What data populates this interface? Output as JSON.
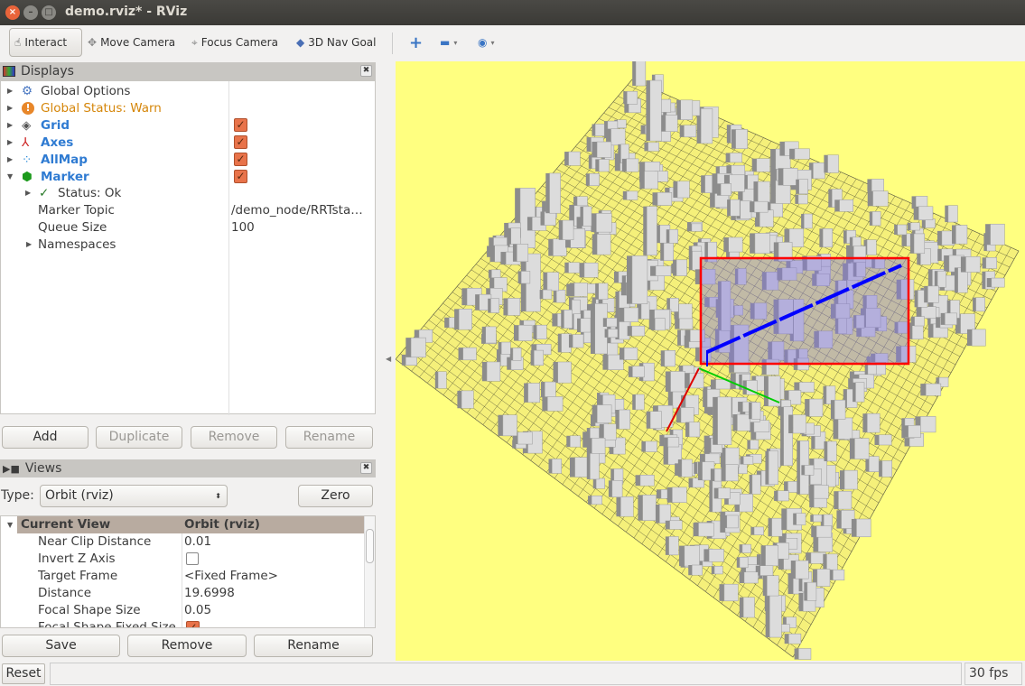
{
  "window": {
    "title": "demo.rviz* - RViz"
  },
  "toolbar": {
    "tools": [
      {
        "label": "Interact",
        "icon": "hand-icon",
        "active": true
      },
      {
        "label": "Move Camera",
        "icon": "move-camera-icon"
      },
      {
        "label": "Focus Camera",
        "icon": "focus-camera-icon"
      },
      {
        "label": "3D Nav Goal",
        "icon": "nav-goal-icon"
      }
    ],
    "extra_icons": [
      "plus-icon",
      "minus-icon",
      "eye-icon"
    ]
  },
  "displays": {
    "title": "Displays",
    "items": [
      {
        "label": "Global Options",
        "icon": "gear-icon",
        "color": "#3c3c3c"
      },
      {
        "label": "Global Status: Warn",
        "icon": "warning-icon",
        "color": "#d5860a"
      },
      {
        "label": "Grid",
        "icon": "grid-icon",
        "color": "#2f7bd2",
        "checked": true
      },
      {
        "label": "Axes",
        "icon": "axes-icon",
        "color": "#2f7bd2",
        "checked": true
      },
      {
        "label": "AllMap",
        "icon": "pointcloud-icon",
        "color": "#2f7bd2",
        "checked": true
      },
      {
        "label": "Marker",
        "icon": "cube-icon",
        "color": "#2f7bd2",
        "checked": true
      }
    ],
    "marker_children": {
      "status": "Status: Ok",
      "topic_label": "Marker Topic",
      "topic_value": "/demo_node/RRTsta…",
      "queue_label": "Queue Size",
      "queue_value": "100",
      "namespaces": "Namespaces"
    },
    "buttons": {
      "add": "Add",
      "duplicate": "Duplicate",
      "remove": "Remove",
      "rename": "Rename"
    }
  },
  "views": {
    "title": "Views",
    "type_label": "Type:",
    "type_value": "Orbit (rviz)",
    "zero": "Zero",
    "header": {
      "name": "Current View",
      "value": "Orbit (rviz)"
    },
    "rows": [
      {
        "name": "Near Clip Distance",
        "value": "0.01"
      },
      {
        "name": "Invert Z Axis",
        "value": "",
        "checkbox": false
      },
      {
        "name": "Target Frame",
        "value": "<Fixed Frame>"
      },
      {
        "name": "Distance",
        "value": "19.6998"
      },
      {
        "name": "Focal Shape Size",
        "value": "0.05"
      },
      {
        "name": "Focal Shape Fixed Size",
        "value": "",
        "checkbox": true
      }
    ],
    "buttons": {
      "save": "Save",
      "remove": "Remove",
      "rename": "Rename"
    }
  },
  "status": {
    "reset": "Reset",
    "fps": "30 fps"
  },
  "colors": {
    "background": "#ffff80",
    "selection_box": "#ff0000",
    "path": "#0000ff"
  }
}
